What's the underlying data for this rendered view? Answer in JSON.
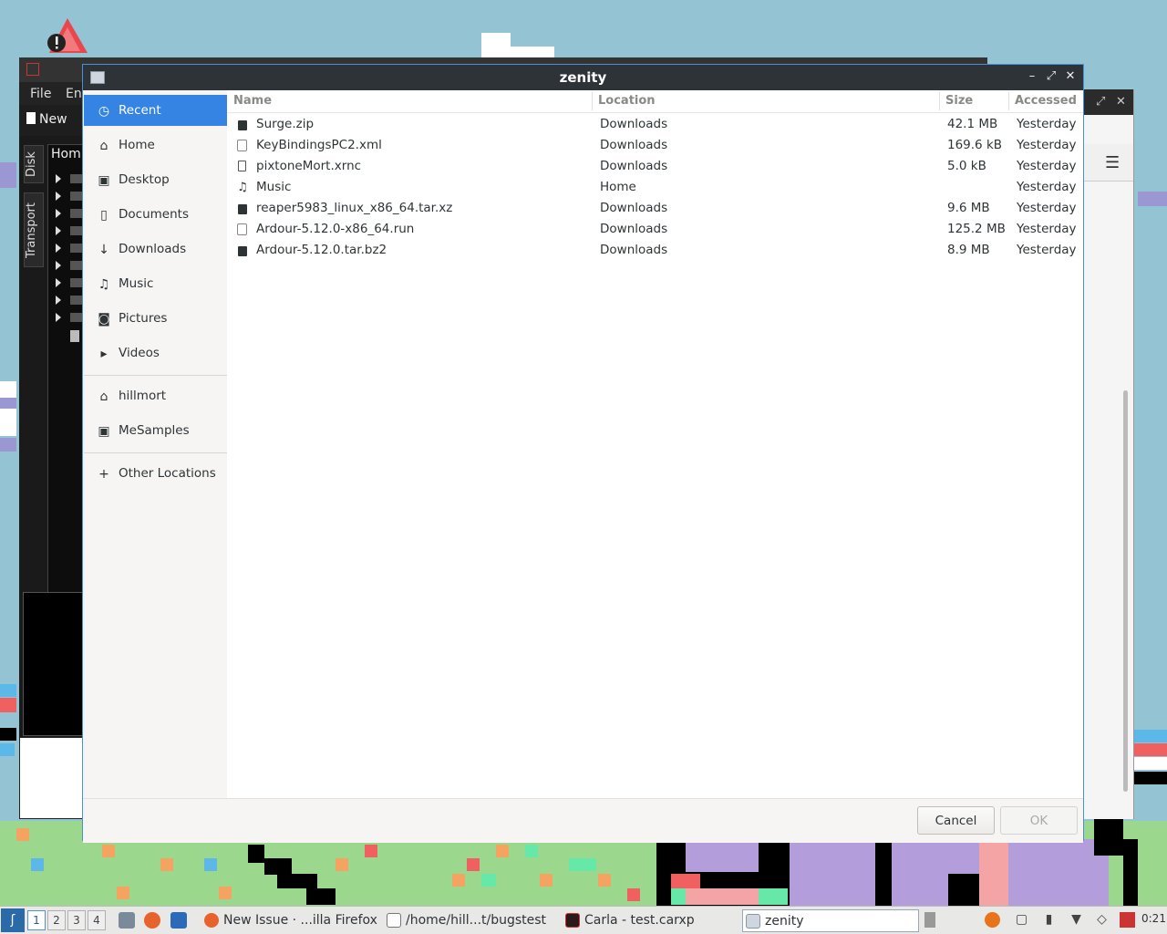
{
  "dialog": {
    "title": "zenity",
    "window_buttons": {
      "minimize": "–",
      "maximize": "⤢",
      "close": "✕"
    }
  },
  "places": {
    "items": [
      {
        "label": "Recent",
        "icon": "clock-icon",
        "glyph": "◷",
        "selected": true
      },
      {
        "label": "Home",
        "icon": "home-icon",
        "glyph": "⌂"
      },
      {
        "label": "Desktop",
        "icon": "folder-icon",
        "glyph": "▣"
      },
      {
        "label": "Documents",
        "icon": "document-icon",
        "glyph": "▯"
      },
      {
        "label": "Downloads",
        "icon": "download-icon",
        "glyph": "↓"
      },
      {
        "label": "Music",
        "icon": "music-icon",
        "glyph": "♫"
      },
      {
        "label": "Pictures",
        "icon": "camera-icon",
        "glyph": "◙"
      },
      {
        "label": "Videos",
        "icon": "video-icon",
        "glyph": "▸"
      }
    ],
    "bookmarks": [
      {
        "label": "hillmort",
        "icon": "home-icon",
        "glyph": "⌂"
      },
      {
        "label": "MeSamples",
        "icon": "folder-icon",
        "glyph": "▣"
      }
    ],
    "other": {
      "label": "Other Locations",
      "icon": "plus-icon",
      "glyph": "+"
    }
  },
  "file_list": {
    "columns": {
      "name": "Name",
      "location": "Location",
      "size": "Size",
      "accessed": "Accessed"
    },
    "rows": [
      {
        "name": "Surge.zip",
        "location": "Downloads",
        "size": "42.1 MB",
        "accessed": "Yesterday",
        "icon": "archive-icon"
      },
      {
        "name": "KeyBindingsPC2.xml",
        "location": "Downloads",
        "size": "169.6 kB",
        "accessed": "Yesterday",
        "icon": "xml-file-icon"
      },
      {
        "name": "pixtoneMort.xrnc",
        "location": "Downloads",
        "size": "5.0 kB",
        "accessed": "Yesterday",
        "icon": "file-icon"
      },
      {
        "name": "Music",
        "location": "Home",
        "size": "",
        "accessed": "Yesterday",
        "icon": "music-folder-icon"
      },
      {
        "name": "reaper5983_linux_x86_64.tar.xz",
        "location": "Downloads",
        "size": "9.6 MB",
        "accessed": "Yesterday",
        "icon": "archive-icon"
      },
      {
        "name": "Ardour-5.12.0-x86_64.run",
        "location": "Downloads",
        "size": "125.2 MB",
        "accessed": "Yesterday",
        "icon": "executable-icon"
      },
      {
        "name": "Ardour-5.12.0.tar.bz2",
        "location": "Downloads",
        "size": "8.9 MB",
        "accessed": "Yesterday",
        "icon": "archive-icon"
      }
    ]
  },
  "buttons": {
    "cancel": "Cancel",
    "ok": "OK"
  },
  "background_app": {
    "menu": [
      "File",
      "En"
    ],
    "toolbar_new": "New",
    "side_tabs": [
      "Disk",
      "Transport"
    ],
    "tree_header": "Hom"
  },
  "taskbar": {
    "workspaces": [
      "1",
      "2",
      "3",
      "4"
    ],
    "active_workspace": "1",
    "tasks": [
      {
        "label": "New Issue · ...illa Firefox",
        "icon": "firefox-icon"
      },
      {
        "label": "/home/hill...t/bugstest",
        "icon": "editor-icon"
      },
      {
        "label": "Carla - test.carxp",
        "icon": "carla-icon"
      },
      {
        "label": "zenity",
        "icon": "window-icon",
        "active": true
      }
    ],
    "clock": "0:21"
  },
  "colors": {
    "accent": "#3584e4",
    "titlebar": "#2e3338",
    "desktop": "#94c4d4"
  }
}
